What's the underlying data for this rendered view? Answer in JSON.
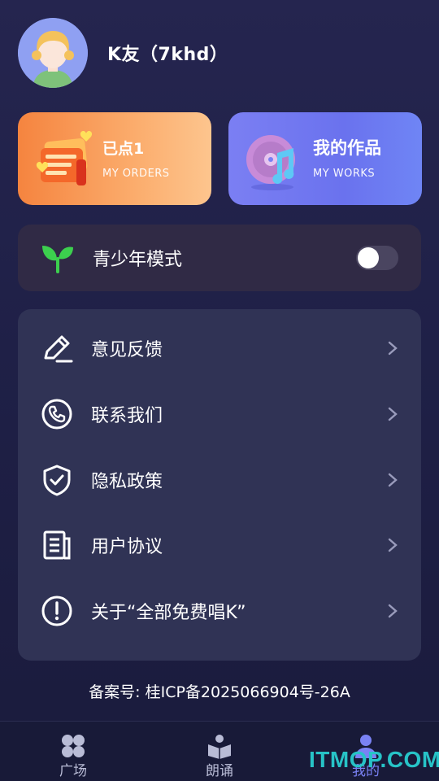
{
  "profile": {
    "username": "K友（7khd）",
    "avatar_icon": "avatar-icon"
  },
  "cards": {
    "orders": {
      "title": "已点1",
      "subtitle": "MY ORDERS",
      "icon": "songbook-icon"
    },
    "works": {
      "title": "我的作品",
      "subtitle": "MY WORKS",
      "icon": "music-disc-icon"
    }
  },
  "teen_mode": {
    "label": "青少年模式",
    "enabled": false,
    "icon": "sprout-icon"
  },
  "menu": {
    "items": [
      {
        "label": "意见反馈",
        "icon": "edit-icon"
      },
      {
        "label": "联系我们",
        "icon": "phone-icon"
      },
      {
        "label": "隐私政策",
        "icon": "shield-check-icon"
      },
      {
        "label": "用户协议",
        "icon": "document-icon"
      },
      {
        "label": "关于“全部免费唱K”",
        "icon": "info-icon"
      }
    ]
  },
  "record": {
    "text": "备案号: 桂ICP备2025066904号-26A"
  },
  "tabbar": {
    "tabs": [
      {
        "label": "广场",
        "icon": "grid-icon",
        "active": false
      },
      {
        "label": "朗诵",
        "icon": "book-reading-icon",
        "active": false
      },
      {
        "label": "我的",
        "icon": "user-icon",
        "active": true
      }
    ]
  },
  "watermark": {
    "text": "ITMOP.COM"
  },
  "colors": {
    "accent": "#7a82f5",
    "orders_card": "#f5843f",
    "works_card": "#7b7ff3",
    "sprout": "#3ccf4e"
  }
}
